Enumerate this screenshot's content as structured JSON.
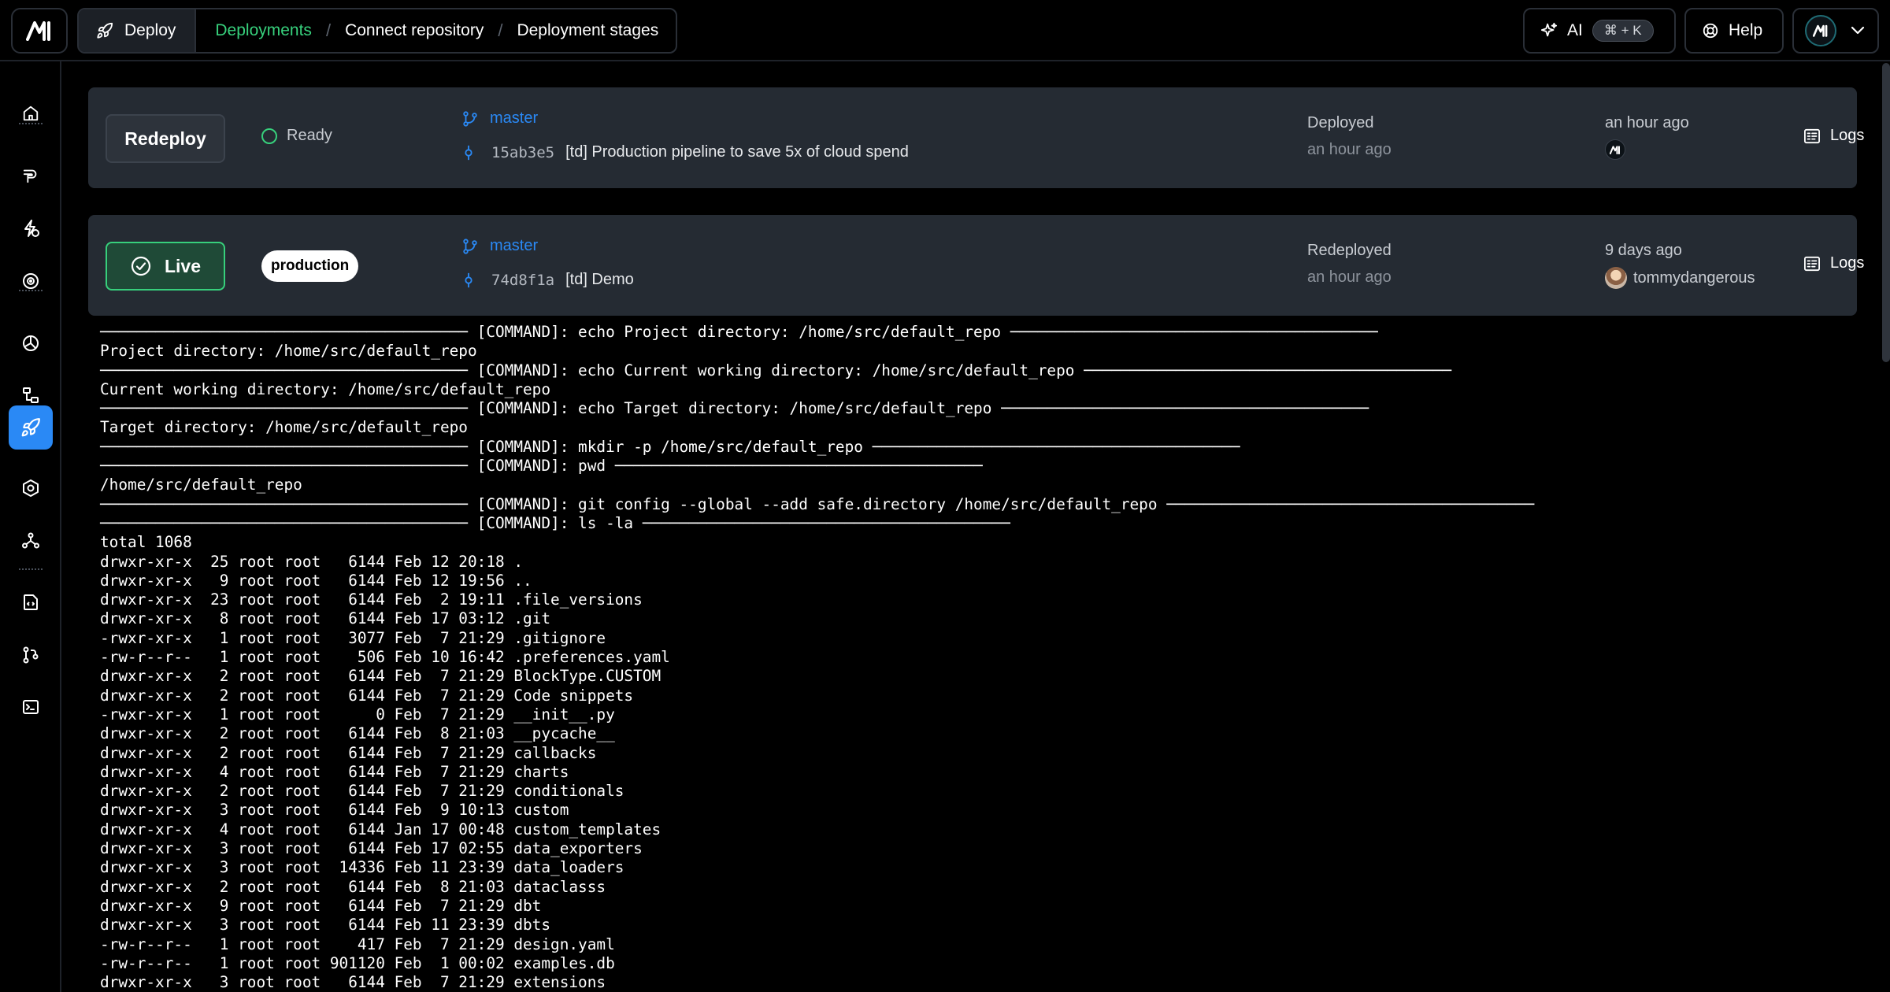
{
  "header": {
    "breadcrumb": {
      "deploy": "Deploy",
      "items": [
        "Deployments",
        "Connect repository",
        "Deployment stages"
      ],
      "separator": "/"
    },
    "ai_label": "AI",
    "ai_shortcut": "⌘ + K",
    "help_label": "Help"
  },
  "deployments": [
    {
      "action_label": "Redeploy",
      "status": "Ready",
      "branch": "master",
      "commit_hash": "15ab3e5",
      "commit_message": "[td] Production pipeline to save 5x of cloud spend",
      "deploy_action": "Deployed",
      "deploy_time": "an hour ago",
      "relative_time": "an hour ago",
      "user": "",
      "logs_label": "Logs"
    },
    {
      "action_label": "Live",
      "environment": "production",
      "branch": "master",
      "commit_hash": "74d8f1a",
      "commit_message": "[td] Demo",
      "deploy_action": "Redeployed",
      "deploy_time": "an hour ago",
      "relative_time": "9 days ago",
      "user": "tommydangerous",
      "logs_label": "Logs"
    }
  ],
  "terminal_lines": [
    "──────────────────────────────────────── [COMMAND]: echo Project directory: /home/src/default_repo ────────────────────────────────────────",
    "Project directory: /home/src/default_repo",
    "──────────────────────────────────────── [COMMAND]: echo Current working directory: /home/src/default_repo ────────────────────────────────────────",
    "Current working directory: /home/src/default_repo",
    "──────────────────────────────────────── [COMMAND]: echo Target directory: /home/src/default_repo ────────────────────────────────────────",
    "Target directory: /home/src/default_repo",
    "──────────────────────────────────────── [COMMAND]: mkdir -p /home/src/default_repo ────────────────────────────────────────",
    "──────────────────────────────────────── [COMMAND]: pwd ────────────────────────────────────────",
    "/home/src/default_repo",
    "──────────────────────────────────────── [COMMAND]: git config --global --add safe.directory /home/src/default_repo ────────────────────────────────────────",
    "──────────────────────────────────────── [COMMAND]: ls -la ────────────────────────────────────────",
    "total 1068",
    "drwxr-xr-x  25 root root   6144 Feb 12 20:18 .",
    "drwxr-xr-x   9 root root   6144 Feb 12 19:56 ..",
    "drwxr-xr-x  23 root root   6144 Feb  2 19:11 .file_versions",
    "drwxr-xr-x   8 root root   6144 Feb 17 03:12 .git",
    "-rwxr-xr-x   1 root root   3077 Feb  7 21:29 .gitignore",
    "-rw-r--r--   1 root root    506 Feb 10 16:42 .preferences.yaml",
    "drwxr-xr-x   2 root root   6144 Feb  7 21:29 BlockType.CUSTOM",
    "drwxr-xr-x   2 root root   6144 Feb  7 21:29 Code snippets",
    "-rwxr-xr-x   1 root root      0 Feb  7 21:29 __init__.py",
    "drwxr-xr-x   2 root root   6144 Feb  8 21:03 __pycache__",
    "drwxr-xr-x   2 root root   6144 Feb  7 21:29 callbacks",
    "drwxr-xr-x   4 root root   6144 Feb  7 21:29 charts",
    "drwxr-xr-x   2 root root   6144 Feb  7 21:29 conditionals",
    "drwxr-xr-x   3 root root   6144 Feb  9 10:13 custom",
    "drwxr-xr-x   4 root root   6144 Jan 17 00:48 custom_templates",
    "drwxr-xr-x   3 root root   6144 Feb 17 02:55 data_exporters",
    "drwxr-xr-x   3 root root  14336 Feb 11 23:39 data_loaders",
    "drwxr-xr-x   2 root root   6144 Feb  8 21:03 dataclasss",
    "drwxr-xr-x   9 root root   6144 Feb  7 21:29 dbt",
    "drwxr-xr-x   3 root root   6144 Feb 11 23:39 dbts",
    "-rw-r--r--   1 root root    417 Feb  7 21:29 design.yaml",
    "-rw-r--r--   1 root root 901120 Feb  1 00:02 examples.db",
    "drwxr-xr-x   3 root root   6144 Feb  7 21:29 extensions"
  ],
  "colors": {
    "accent_green": "#37d07c",
    "accent_blue": "#2a89f5",
    "card_bg": "#252b33",
    "page_bg": "#000000"
  },
  "icons": {
    "logo": "mage-logo-icon",
    "deploy": "rocket-icon",
    "ai": "sparkles-icon",
    "help": "help-ring-icon",
    "branch": "git-branch-icon",
    "commit": "git-commit-icon",
    "logs": "logs-icon",
    "live": "check-circle-icon"
  }
}
